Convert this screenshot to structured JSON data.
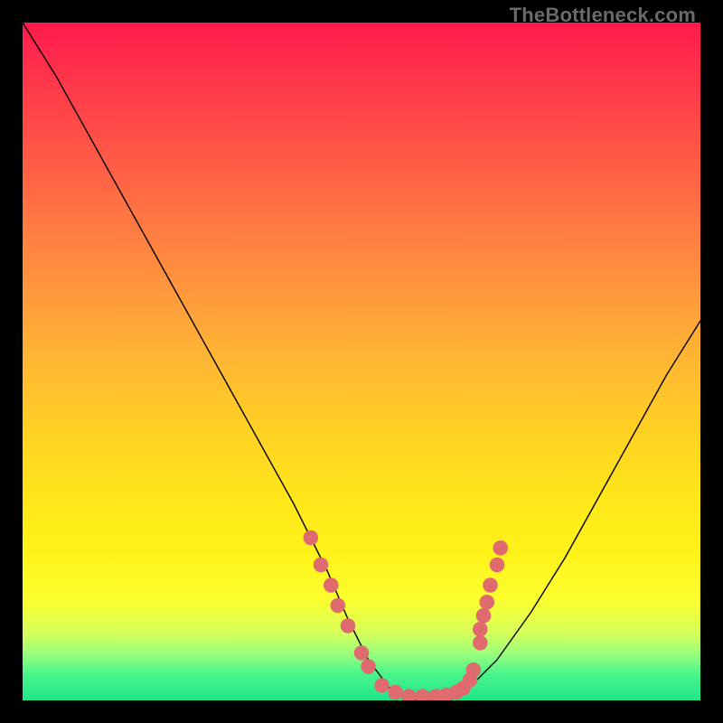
{
  "attribution": "TheBottleneck.com",
  "chart_data": {
    "type": "line",
    "title": "",
    "xlabel": "",
    "ylabel": "",
    "xlim": [
      0,
      100
    ],
    "ylim": [
      0,
      100
    ],
    "series": [
      {
        "name": "curve",
        "x": [
          0,
          5,
          10,
          15,
          20,
          25,
          30,
          35,
          40,
          45,
          48,
          51,
          54,
          57,
          60,
          63,
          66,
          70,
          75,
          80,
          85,
          90,
          95,
          100
        ],
        "y": [
          100,
          92,
          83,
          74,
          65,
          56,
          47,
          38,
          29,
          19,
          12,
          6,
          2,
          0,
          0,
          0,
          2,
          6,
          13,
          21,
          30,
          39,
          48,
          56
        ]
      }
    ],
    "markers": [
      {
        "x": 42.5,
        "y": 24
      },
      {
        "x": 44.0,
        "y": 20
      },
      {
        "x": 45.5,
        "y": 17
      },
      {
        "x": 46.5,
        "y": 14
      },
      {
        "x": 48.0,
        "y": 11
      },
      {
        "x": 50.0,
        "y": 7
      },
      {
        "x": 51.0,
        "y": 5
      },
      {
        "x": 53.0,
        "y": 2.2
      },
      {
        "x": 55.0,
        "y": 1.2
      },
      {
        "x": 57.0,
        "y": 0.6
      },
      {
        "x": 59.0,
        "y": 0.6
      },
      {
        "x": 61.0,
        "y": 0.6
      },
      {
        "x": 62.5,
        "y": 0.8
      },
      {
        "x": 64.0,
        "y": 1.2
      },
      {
        "x": 65.0,
        "y": 1.8
      },
      {
        "x": 66.0,
        "y": 3.0
      },
      {
        "x": 66.5,
        "y": 4.5
      },
      {
        "x": 67.5,
        "y": 8.5
      },
      {
        "x": 67.5,
        "y": 10.5
      },
      {
        "x": 68.0,
        "y": 12.5
      },
      {
        "x": 68.5,
        "y": 14.5
      },
      {
        "x": 69.0,
        "y": 17
      },
      {
        "x": 70.0,
        "y": 20
      },
      {
        "x": 70.5,
        "y": 22.5
      }
    ],
    "marker_color": "#df6b6f",
    "marker_radius": 1.1
  }
}
